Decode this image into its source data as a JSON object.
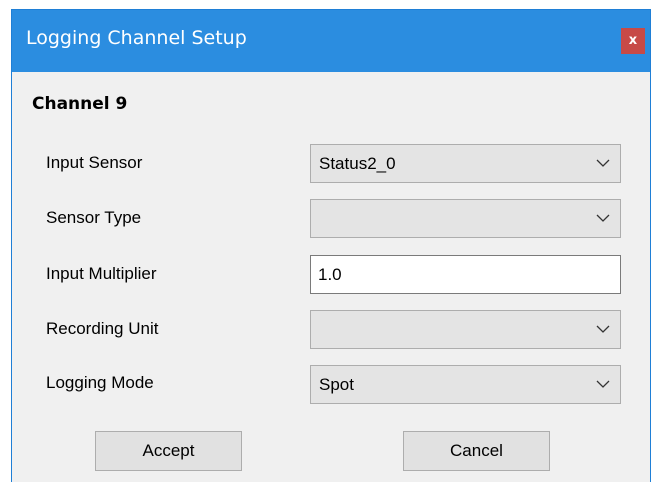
{
  "window": {
    "title": "Logging Channel Setup",
    "close_label": "x"
  },
  "channel": {
    "heading": "Channel 9"
  },
  "fields": {
    "input_sensor": {
      "label": "Input Sensor",
      "value": "Status2_0"
    },
    "sensor_type": {
      "label": "Sensor Type",
      "value": ""
    },
    "input_multiplier": {
      "label": "Input Multiplier",
      "value": "1.0"
    },
    "recording_unit": {
      "label": "Recording Unit",
      "value": ""
    },
    "logging_mode": {
      "label": "Logging Mode",
      "value": "Spot"
    }
  },
  "buttons": {
    "accept_label": "Accept",
    "cancel_label": "Cancel"
  },
  "colors": {
    "titlebar": "#2b8de0",
    "close_button": "#c74a47",
    "dialog_background": "#f0f0f0"
  },
  "icons": {
    "close": "close-icon",
    "dropdown": "chevron-down-icon"
  }
}
